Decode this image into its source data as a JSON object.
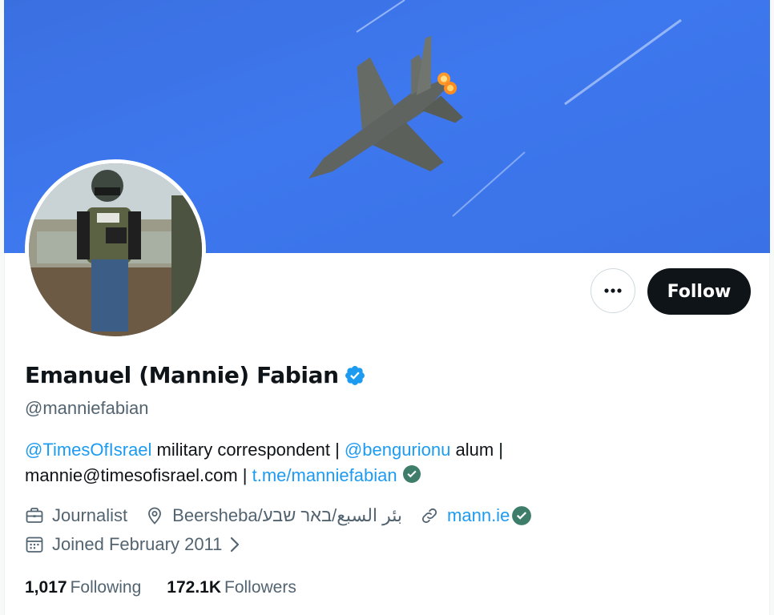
{
  "profile": {
    "display_name": "Emanuel (Mannie) Fabian",
    "handle": "@manniefabian",
    "banner_image": "fighter-jet-in-blue-sky",
    "avatar_image": "journalist-in-press-vest-and-helmet"
  },
  "actions": {
    "more_icon": "more-horizontal-icon",
    "follow_label": "Follow"
  },
  "bio": {
    "mention_1": "@TimesOfIsrael",
    "text_1": " military correspondent  | ",
    "mention_2": "@bengurionu",
    "text_2": " alum |",
    "email_text": "mannie@timesofisrael.com | ",
    "link_text": "t.me/manniefabian"
  },
  "meta": {
    "profession": "Journalist",
    "location": "Beersheba/بئر السبع/באר שבע",
    "website": "mann.ie",
    "joined": "Joined February 2011"
  },
  "stats": {
    "following_count": "1,017",
    "following_label": "Following",
    "followers_count": "172.1K",
    "followers_label": "Followers"
  },
  "colors": {
    "link": "#1d9bf0",
    "verified_blue": "#1d9bf0",
    "verified_green": "#3e7d6a",
    "secondary_text": "#536471",
    "follow_bg": "#0f1419"
  }
}
